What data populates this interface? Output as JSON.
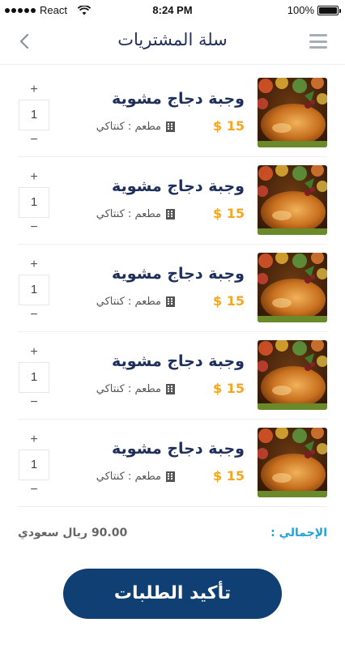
{
  "status_bar": {
    "carrier": "React",
    "time": "8:24 PM",
    "battery": "100%",
    "battery_level": 1.0
  },
  "header": {
    "title": "سلة المشتريات",
    "back_icon": "chevron-left-icon",
    "menu_icon": "hamburger-menu-icon"
  },
  "cart": {
    "items": [
      {
        "title": "وجبة دجاج مشوية",
        "price": "15 $",
        "restaurant": "مطعم : كنتاكي",
        "quantity": "1",
        "plus": "+",
        "minus": "−"
      },
      {
        "title": "وجبة دجاج مشوية",
        "price": "15 $",
        "restaurant": "مطعم : كنتاكي",
        "quantity": "1",
        "plus": "+",
        "minus": "−"
      },
      {
        "title": "وجبة دجاج مشوية",
        "price": "15 $",
        "restaurant": "مطعم : كنتاكي",
        "quantity": "1",
        "plus": "+",
        "minus": "−"
      },
      {
        "title": "وجبة دجاج مشوية",
        "price": "15 $",
        "restaurant": "مطعم : كنتاكي",
        "quantity": "1",
        "plus": "+",
        "minus": "−"
      },
      {
        "title": "وجبة دجاج مشوية",
        "price": "15 $",
        "restaurant": "مطعم : كنتاكي",
        "quantity": "1",
        "plus": "+",
        "minus": "−"
      }
    ]
  },
  "total": {
    "label": "الإجمالي :",
    "value": "90.00 ريال سعودي"
  },
  "confirm_button": {
    "label": "تأكيد الطلبات"
  },
  "colors": {
    "primary": "#0f3f73",
    "title_text": "#1f2f5c",
    "price": "#f5a623",
    "total_label": "#1fa3d8"
  }
}
